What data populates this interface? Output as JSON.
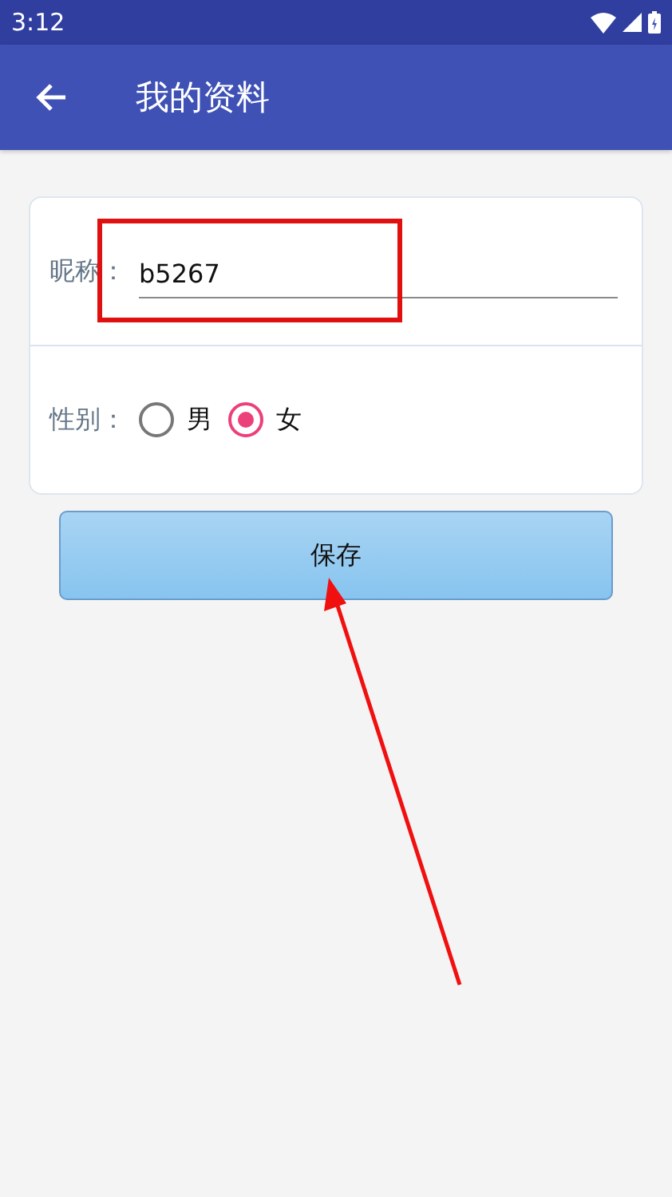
{
  "status_bar": {
    "time": "3:12"
  },
  "app_bar": {
    "title": "我的资料"
  },
  "form": {
    "nickname": {
      "label": "昵称：",
      "value": "b5267"
    },
    "gender": {
      "label": "性别：",
      "options": [
        {
          "label": "男",
          "selected": false
        },
        {
          "label": "女",
          "selected": true
        }
      ]
    }
  },
  "save_button": "保存"
}
